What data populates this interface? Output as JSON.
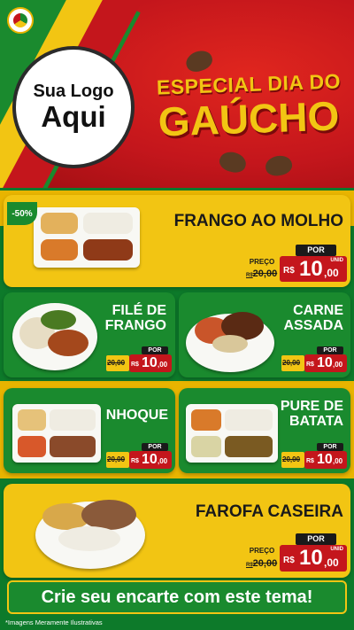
{
  "header": {
    "logo_line1": "Sua Logo",
    "logo_line2": "Aqui",
    "title_line1": "ESPECIAL DIA DO",
    "title_line2": "GAÚCHO"
  },
  "items": [
    {
      "name": "FRANGO AO MOLHO",
      "discount": "-50%",
      "preco_label": "PREÇO",
      "old_price": "20,00",
      "por_label": "POR",
      "unid_label": "UNID",
      "currency": "R$",
      "price_int": "10",
      "price_dec": ",00"
    },
    {
      "name_l1": "FILÉ DE",
      "name_l2": "FRANGO",
      "por_label": "POR",
      "old_price": "20,00",
      "currency": "R$",
      "price_int": "10",
      "price_dec": ",00"
    },
    {
      "name_l1": "CARNE",
      "name_l2": "ASSADA",
      "por_label": "POR",
      "old_price": "20,00",
      "currency": "R$",
      "price_int": "10",
      "price_dec": ",00"
    },
    {
      "name": "NHOQUE",
      "por_label": "POR",
      "old_price": "20,00",
      "currency": "R$",
      "price_int": "10",
      "price_dec": ",00"
    },
    {
      "name_l1": "PURE DE",
      "name_l2": "BATATA",
      "por_label": "POR",
      "old_price": "20,00",
      "currency": "R$",
      "price_int": "10",
      "price_dec": ",00"
    },
    {
      "name": "FAROFA CASEIRA",
      "preco_label": "PREÇO",
      "old_price": "20,00",
      "por_label": "POR",
      "unid_label": "UNID",
      "currency": "R$",
      "price_int": "10",
      "price_dec": ",00"
    }
  ],
  "banner": "Crie seu encarte com este tema!",
  "disclaimer": "*Imagens Meramente Ilustrativas",
  "colors": {
    "red": "#c4161c",
    "green": "#1a8a2e",
    "yellow": "#f2c513"
  }
}
